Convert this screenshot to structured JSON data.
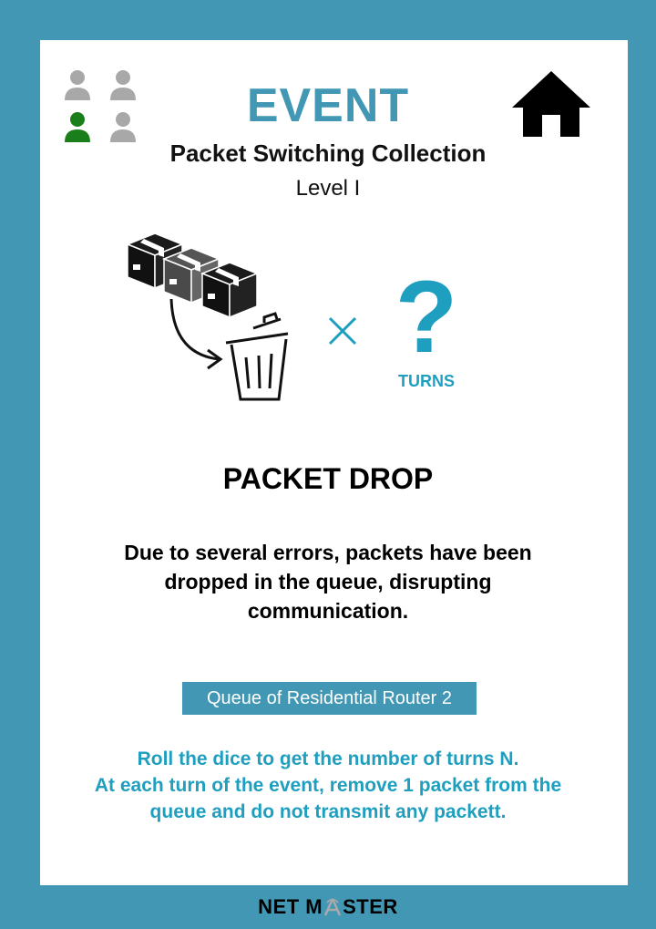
{
  "card": {
    "title": "EVENT",
    "subtitle": "Packet Switching Collection",
    "level": "Level I",
    "event_name": "PACKET DROP",
    "description_lines": [
      "Due to several errors,  packets have been",
      "dropped in the queue,  disrupting",
      "communication."
    ],
    "target_label": "Queue of Residential Router 2",
    "instruction_lines": [
      "Roll the dice to get the number of turns N.",
      "At each turn of the event, remove 1 packet from the",
      "queue and do not transmit any packett."
    ],
    "turns_symbol": "?",
    "turns_label": "TURNS",
    "multiply_symbol": "×"
  },
  "players": [
    {
      "icon": "person-icon",
      "active": false
    },
    {
      "icon": "person-icon",
      "active": false
    },
    {
      "icon": "person-icon",
      "active": true
    },
    {
      "icon": "person-icon",
      "active": false
    }
  ],
  "brand": {
    "text_before": "NET M",
    "text_after": "STER"
  },
  "colors": {
    "frame": "#4298b4",
    "accent": "#1f9fbf",
    "player_inactive": "#a8a8a8",
    "player_active": "#1a7f1a"
  }
}
